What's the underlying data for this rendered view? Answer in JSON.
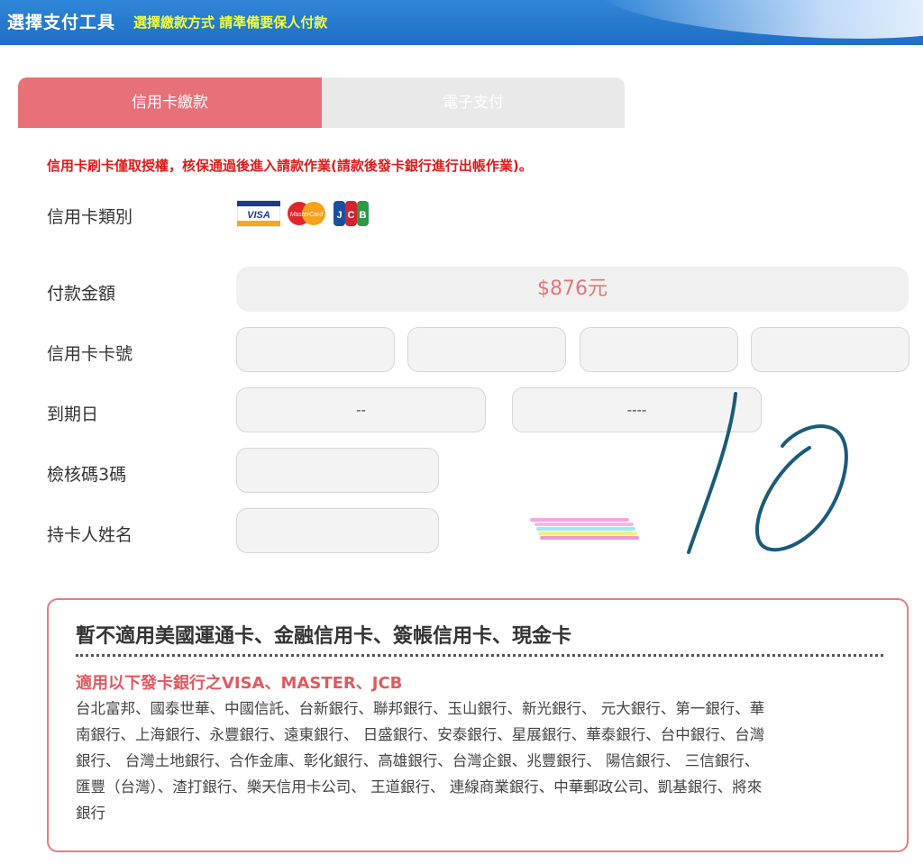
{
  "header": {
    "title": "選擇支付工具",
    "subtitle": "選擇繳款方式 請準備要保人付款"
  },
  "tabs": [
    {
      "label": "信用卡繳款",
      "active": true
    },
    {
      "label": "電子支付",
      "active": false
    }
  ],
  "notice": "信用卡刷卡僅取授權，核保通過後進入請款作業(請款後發卡銀行進行出帳作業)。",
  "form": {
    "card_type_label": "信用卡類別",
    "card_logos": {
      "visa": "VISA",
      "mastercard": "MasterCard",
      "jcb": "JCB"
    },
    "amount_label": "付款金額",
    "amount_value": "$876元",
    "card_number_label": "信用卡卡號",
    "card_number_values": [
      "",
      "",
      "",
      ""
    ],
    "expiry_label": "到期日",
    "expiry_month": "--",
    "expiry_year": "----",
    "cvv_label": "檢核碼3碼",
    "cvv_value": "",
    "holder_label": "持卡人姓名"
  },
  "annotation": {
    "handwritten": "10",
    "color": "#1a5b7a"
  },
  "info_panel": {
    "title": "暫不適用美國運通卡、金融信用卡、簽帳信用卡、現金卡",
    "subtitle": "適用以下發卡銀行之VISA、MASTER、JCB",
    "banks": [
      "台北富邦、國泰世華、中國信託、台新銀行、聯邦銀行、玉山銀行、新光銀行、 元大銀行、第一銀行、華",
      "南銀行、上海銀行、永豐銀行、遠東銀行、 日盛銀行、安泰銀行、星展銀行、華泰銀行、台中銀行、台灣",
      "銀行、 台灣土地銀行、合作金庫、彰化銀行、高雄銀行、台灣企銀、兆豐銀行、 陽信銀行、 三信銀行、",
      "匯豐（台灣）、渣打銀行、樂天信用卡公司、 王道銀行、 連線商業銀行、中華郵政公司、凱基銀行、將來",
      "銀行"
    ]
  },
  "colors": {
    "header_bg": "#2678cf",
    "header_sub": "#f2ff3a",
    "tab_active": "#e87077",
    "tab_inactive": "#e9e9e9",
    "notice": "#e01b1b",
    "amount": "#e2767a",
    "panel_border": "#e87b80"
  }
}
